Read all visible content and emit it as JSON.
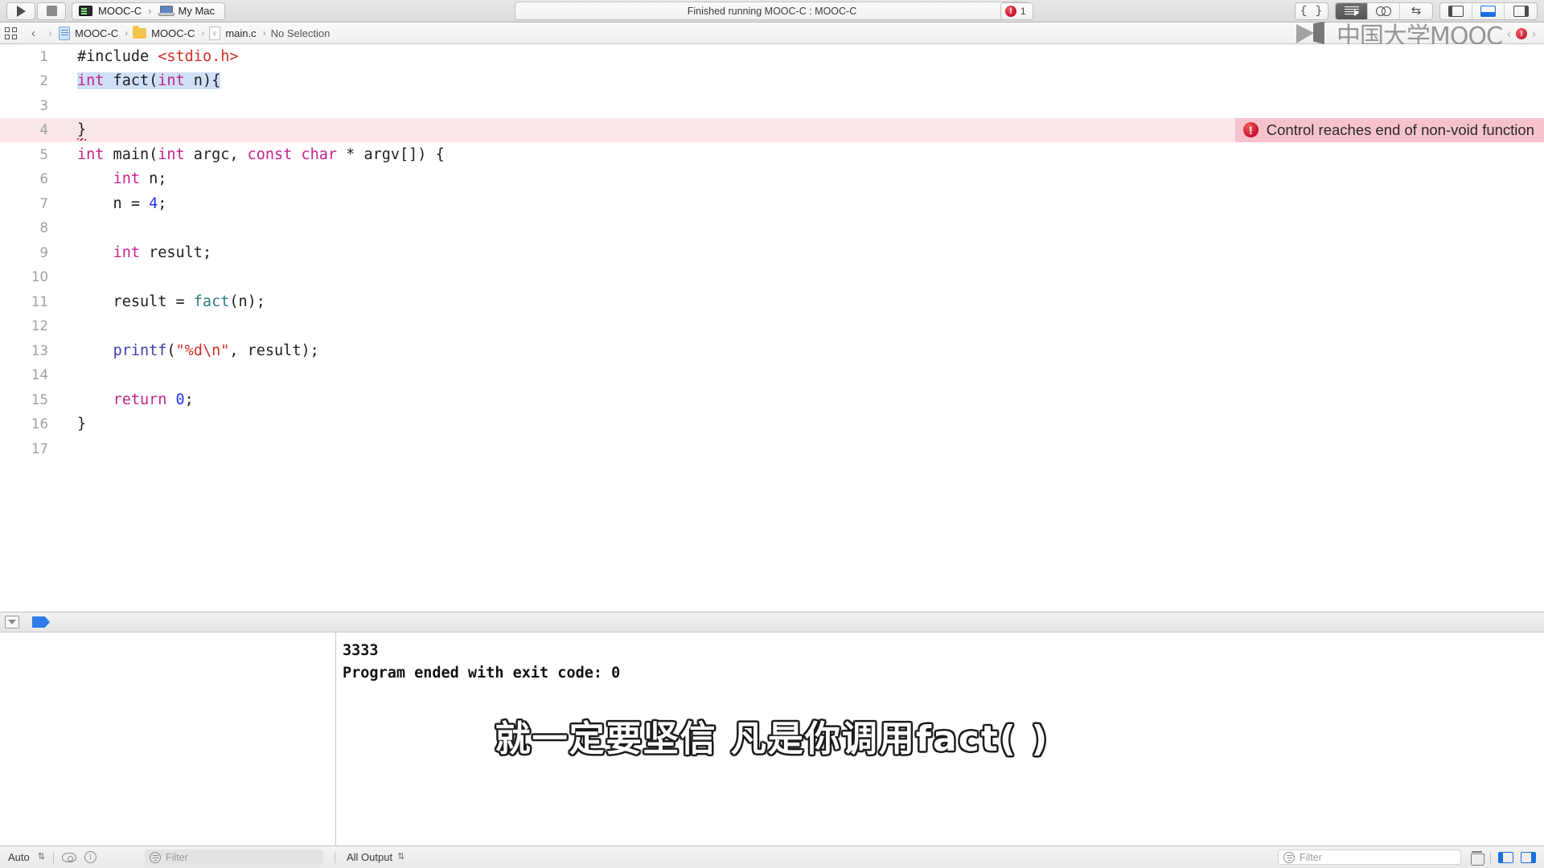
{
  "toolbar": {
    "run_label": "run-button",
    "stop_label": "stop-button",
    "scheme": "MOOC-C",
    "destination": "My Mac",
    "scheme_sep": "›",
    "status_text": "Finished running MOOC-C : MOOC-C",
    "issue_count": "1",
    "error_glyph": "!",
    "brace_label": "{ }",
    "editor_segments": [
      "standard-editor",
      "assistant-editor",
      "version-editor"
    ],
    "pane_toggles": [
      "navigator-pane",
      "debug-pane",
      "utilities-pane"
    ]
  },
  "jumpbar": {
    "grid_icon": "related-items-icon",
    "back": "‹",
    "forward": "›",
    "separator": "›",
    "crumbs": [
      {
        "icon": "project-icon",
        "label": "MOOC-C"
      },
      {
        "icon": "folder-icon",
        "label": "MOOC-C"
      },
      {
        "icon": "c-file-icon",
        "label": "main.c"
      }
    ],
    "selection": "No Selection"
  },
  "watermark": {
    "text": "中国大学MOOC",
    "left_chevron": "‹",
    "right_chevron": "›",
    "error_glyph": "!"
  },
  "editor": {
    "error_banner": {
      "glyph": "!",
      "message": "Control reaches end of non-void function"
    },
    "lines": [
      {
        "n": "1",
        "tokens": [
          {
            "t": "#include ",
            "c": "pun"
          },
          {
            "t": "<stdio.h>",
            "c": "str"
          }
        ]
      },
      {
        "n": "2",
        "selected": true,
        "tokens": [
          {
            "t": "int",
            "c": "kw"
          },
          {
            "t": " fact(",
            "c": "pun"
          },
          {
            "t": "int",
            "c": "kw"
          },
          {
            "t": " n){",
            "c": "pun"
          }
        ]
      },
      {
        "n": "3",
        "tokens": []
      },
      {
        "n": "4",
        "error": true,
        "tokens": [
          {
            "t": "}",
            "c": "pun squig"
          }
        ]
      },
      {
        "n": "5",
        "tokens": [
          {
            "t": "int",
            "c": "kw"
          },
          {
            "t": " main(",
            "c": "pun"
          },
          {
            "t": "int",
            "c": "kw"
          },
          {
            "t": " argc, ",
            "c": "pun"
          },
          {
            "t": "const",
            "c": "kw"
          },
          {
            "t": " ",
            "c": "pun"
          },
          {
            "t": "char",
            "c": "kw"
          },
          {
            "t": " * argv[]) {",
            "c": "pun"
          }
        ]
      },
      {
        "n": "6",
        "tokens": [
          {
            "t": "    ",
            "c": "pun"
          },
          {
            "t": "int",
            "c": "kw"
          },
          {
            "t": " n;",
            "c": "pun"
          }
        ]
      },
      {
        "n": "7",
        "tokens": [
          {
            "t": "    n = ",
            "c": "pun"
          },
          {
            "t": "4",
            "c": "num"
          },
          {
            "t": ";",
            "c": "pun"
          }
        ]
      },
      {
        "n": "8",
        "tokens": []
      },
      {
        "n": "9",
        "tokens": [
          {
            "t": "    ",
            "c": "pun"
          },
          {
            "t": "int",
            "c": "kw"
          },
          {
            "t": " result;",
            "c": "pun"
          }
        ]
      },
      {
        "n": "10",
        "tokens": []
      },
      {
        "n": "11",
        "tokens": [
          {
            "t": "    result = ",
            "c": "pun"
          },
          {
            "t": "fact",
            "c": "fn"
          },
          {
            "t": "(n);",
            "c": "pun"
          }
        ]
      },
      {
        "n": "12",
        "tokens": []
      },
      {
        "n": "13",
        "tokens": [
          {
            "t": "    ",
            "c": "pun"
          },
          {
            "t": "printf",
            "c": "fnc"
          },
          {
            "t": "(",
            "c": "pun"
          },
          {
            "t": "\"%d\\n\"",
            "c": "str"
          },
          {
            "t": ", result);",
            "c": "pun"
          }
        ]
      },
      {
        "n": "14",
        "tokens": []
      },
      {
        "n": "15",
        "tokens": [
          {
            "t": "    ",
            "c": "pun"
          },
          {
            "t": "return",
            "c": "kw"
          },
          {
            "t": " ",
            "c": "pun"
          },
          {
            "t": "0",
            "c": "num"
          },
          {
            "t": ";",
            "c": "pun"
          }
        ]
      },
      {
        "n": "16",
        "tokens": [
          {
            "t": "}",
            "c": "pun"
          }
        ]
      },
      {
        "n": "17",
        "tokens": []
      }
    ]
  },
  "debug": {
    "collapse_icon": "collapse-debug-icon",
    "flag_icon": "breakpoint-flag-icon",
    "console_lines": [
      "3333",
      "Program ended with exit code: 0"
    ]
  },
  "subtitle": {
    "text": "就一定要坚信 凡是你调用fact( )"
  },
  "statusbar": {
    "auto_label": "Auto",
    "stepper_glyph": "⇅",
    "variables_filter_placeholder": "Filter",
    "output_scope": "All Output",
    "console_filter_placeholder": "Filter",
    "trash_icon": "clear-console-icon"
  },
  "colors": {
    "keyword": "#c3248f",
    "string": "#d12f28",
    "number": "#2633e8",
    "function": "#2e7d82",
    "stdlib_function": "#3f3fa8",
    "error_red": "#c8102e",
    "error_row_bg": "#fbe6e9",
    "error_banner_bg": "#f6c3cc",
    "selection_blue": "#cfe0f7",
    "accent_blue": "#1a6fe0"
  }
}
